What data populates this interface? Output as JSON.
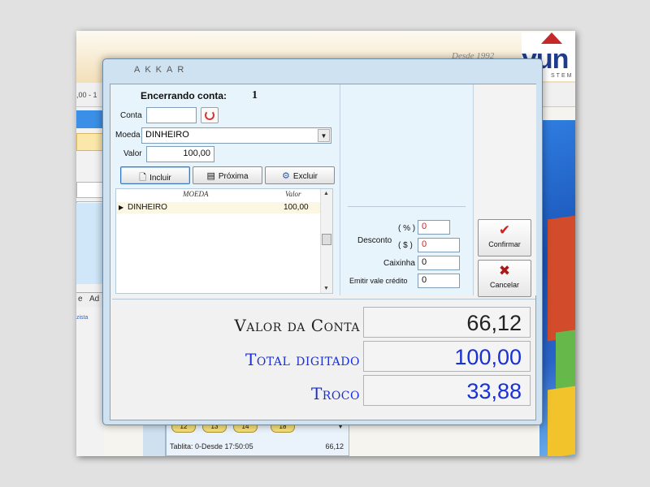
{
  "background": {
    "slogan": "Desde 1992",
    "brand_name": "yun",
    "brand_sub": "STEM",
    "toolbar_text": ",00 - 1",
    "tab_labels": [
      "e",
      "Ad"
    ],
    "link_text": "zista",
    "table_chips": [
      "12",
      "13",
      "14",
      "18"
    ],
    "status_text": "Tablita: 0-Desde 17:50:05",
    "status_total": "66,12"
  },
  "dialog": {
    "title": "AKKAR",
    "heading": "Encerrando conta:",
    "account_number": "1",
    "fields": {
      "conta_label": "Conta",
      "conta_value": "",
      "moeda_label": "Moeda",
      "moeda_value": "DINHEIRO",
      "valor_label": "Valor",
      "valor_value": "100,00"
    },
    "buttons": {
      "incluir": "Incluir",
      "proxima": "Próxima",
      "excluir": "Excluir",
      "confirmar": "Confirmar",
      "cancelar": "Cancelar"
    },
    "grid": {
      "headers": [
        "MOEDA",
        "Valor"
      ],
      "rows": [
        {
          "moeda": "DINHEIRO",
          "valor": "100,00"
        }
      ]
    },
    "discount": {
      "pct_label": "( % )",
      "pct_value": "0",
      "desconto_label": "Desconto",
      "amt_label": "( $ )",
      "amt_value": "0",
      "caixinha_label": "Caixinha",
      "caixinha_value": "0",
      "vale_label": "Emitir vale crédito",
      "vale_value": "0"
    },
    "summary": {
      "valor_conta_label": "Valor da Conta",
      "valor_conta_value": "66,12",
      "total_label": "Total digitado",
      "total_value": "100,00",
      "troco_label": "Troco",
      "troco_value": "33,88"
    }
  },
  "colors": {
    "summary_dark": "#222222",
    "summary_blue": "#1a2fd6",
    "discount_value_red": "#d62020",
    "confirm_red": "#cc2222"
  },
  "icons": [
    "refresh-icon",
    "dropdown-arrow-icon",
    "new-document-icon",
    "next-icon",
    "delete-icon",
    "checkmark-icon",
    "cross-icon",
    "row-pointer-icon"
  ]
}
